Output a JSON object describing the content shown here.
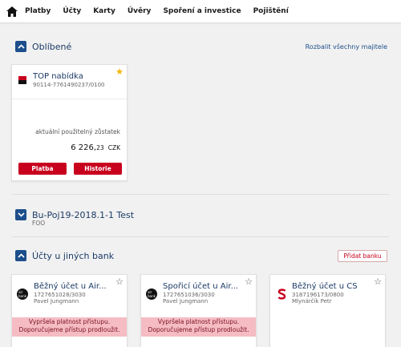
{
  "nav": {
    "items": [
      "Platby",
      "Účty",
      "Karty",
      "Úvěry",
      "Spoření a investice",
      "Pojištění"
    ]
  },
  "favorites": {
    "title": "Oblíbené",
    "expand_link": "Rozbalit všechny majitele",
    "card": {
      "name": "TOP nabídka",
      "number": "90114-7761490237/0100",
      "balance_label": "aktuální použitelný zůstatek",
      "balance_main": "6 226,",
      "balance_cents": "23",
      "currency": "CZK",
      "pay_label": "Platba",
      "history_label": "Historie"
    }
  },
  "group2": {
    "title": "Bu-Poj19-2018.1-1 Test",
    "subtitle": "FOO"
  },
  "other_banks": {
    "title": "Účty u jiných bank",
    "add_label": "Přidat banku",
    "cards": [
      {
        "name": "Běžný účet u Air...",
        "number": "1727651028/3030",
        "owner": "Pavel Jungmann",
        "logo": "air",
        "warning_1": "Vypršela platnost přístupu.",
        "warning_2": "Doporučujeme přístup prodloužit."
      },
      {
        "name": "Spořicí účet u Air...",
        "number": "1727651036/3030",
        "owner": "Pavel Jungmann",
        "logo": "air",
        "warning_1": "Vypršela platnost přístupu.",
        "warning_2": "Doporučujeme přístup prodloužit."
      },
      {
        "name": "Běžný účet u ČS",
        "number": "3187196173/0800",
        "owner": "Mlynárčík Petr",
        "logo": "cs"
      }
    ]
  },
  "colors": {
    "accent_blue": "#1d4f8b",
    "brand_red": "#c8001e",
    "warning_bg": "#f5bcc3",
    "star_gold": "#f2b600"
  }
}
